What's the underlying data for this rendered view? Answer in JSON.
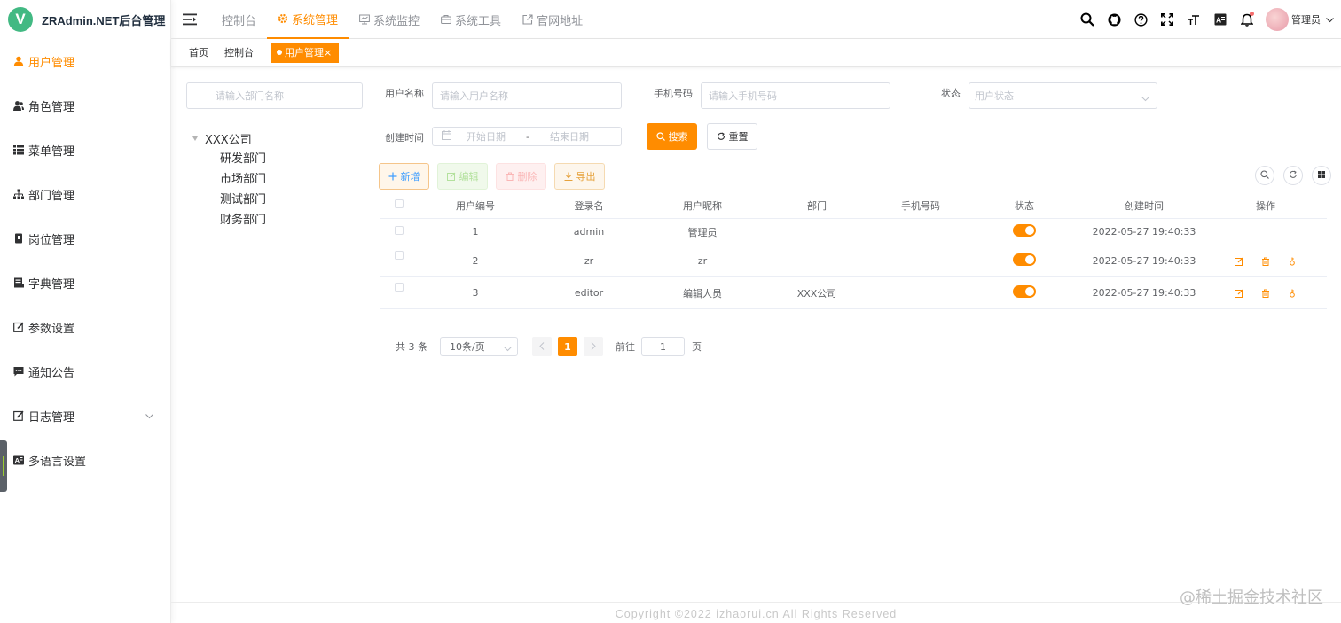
{
  "logo": {
    "mark": "V",
    "title": "ZRAdmin.NET后台管理"
  },
  "sidebar": {
    "items": [
      {
        "label": "用户管理",
        "icon": "user-icon",
        "active": true
      },
      {
        "label": "角色管理",
        "icon": "role-icon"
      },
      {
        "label": "菜单管理",
        "icon": "menu-tree-icon"
      },
      {
        "label": "部门管理",
        "icon": "org-tree-icon"
      },
      {
        "label": "岗位管理",
        "icon": "post-icon"
      },
      {
        "label": "字典管理",
        "icon": "dict-icon"
      },
      {
        "label": "参数设置",
        "icon": "edit-icon"
      },
      {
        "label": "通知公告",
        "icon": "message-icon"
      },
      {
        "label": "日志管理",
        "icon": "log-icon",
        "expandable": true
      },
      {
        "label": "多语言设置",
        "icon": "language-icon"
      }
    ]
  },
  "topnav": {
    "items": [
      {
        "label": "控制台"
      },
      {
        "label": "系统管理",
        "active": true,
        "icon": "gear-icon"
      },
      {
        "label": "系统监控",
        "icon": "monitor-icon"
      },
      {
        "label": "系统工具",
        "icon": "toolbox-icon"
      },
      {
        "label": "官网地址",
        "icon": "external-link-icon"
      }
    ],
    "user_name": "管理员"
  },
  "tags": [
    {
      "label": "首页"
    },
    {
      "label": "控制台"
    },
    {
      "label": "用户管理",
      "active": true,
      "close": "×"
    }
  ],
  "dept": {
    "search_placeholder": "请输入部门名称",
    "root": "XXX公司",
    "children": [
      "研发部门",
      "市场部门",
      "测试部门",
      "财务部门"
    ]
  },
  "search": {
    "username_label": "用户名称",
    "username_placeholder": "请输入用户名称",
    "phone_label": "手机号码",
    "phone_placeholder": "请输入手机号码",
    "status_label": "状态",
    "status_placeholder": "用户状态",
    "date_label": "创建时间",
    "date_start": "开始日期",
    "date_sep": "-",
    "date_end": "结束日期",
    "search_btn": "搜索",
    "reset_btn": "重置"
  },
  "toolbar": {
    "add": "新增",
    "edit": "编辑",
    "delete": "删除",
    "export": "导出"
  },
  "table": {
    "headers": [
      "用户编号",
      "登录名",
      "用户昵称",
      "部门",
      "手机号码",
      "状态",
      "创建时间",
      "操作"
    ],
    "rows": [
      {
        "id": "1",
        "login": "admin",
        "nick": "管理员",
        "dept": "",
        "phone": "",
        "status": true,
        "created": "2022-05-27 19:40:33",
        "ops": false
      },
      {
        "id": "2",
        "login": "zr",
        "nick": "zr",
        "dept": "",
        "phone": "",
        "status": true,
        "created": "2022-05-27 19:40:33",
        "ops": true
      },
      {
        "id": "3",
        "login": "editor",
        "nick": "编辑人员",
        "dept": "XXX公司",
        "phone": "",
        "status": true,
        "created": "2022-05-27 19:40:33",
        "ops": true
      }
    ]
  },
  "pager": {
    "total": "共 3 条",
    "page_size": "10条/页",
    "current": "1",
    "goto_label": "前往",
    "goto_value": "1",
    "page_suffix": "页"
  },
  "footer": {
    "copyright": "Copyright ©2022 izhaorui.cn All Rights Reserved"
  },
  "watermark": "@稀土掘金技术社区",
  "colors": {
    "accent": "#ff8c00",
    "brand_green": "#42b983"
  }
}
